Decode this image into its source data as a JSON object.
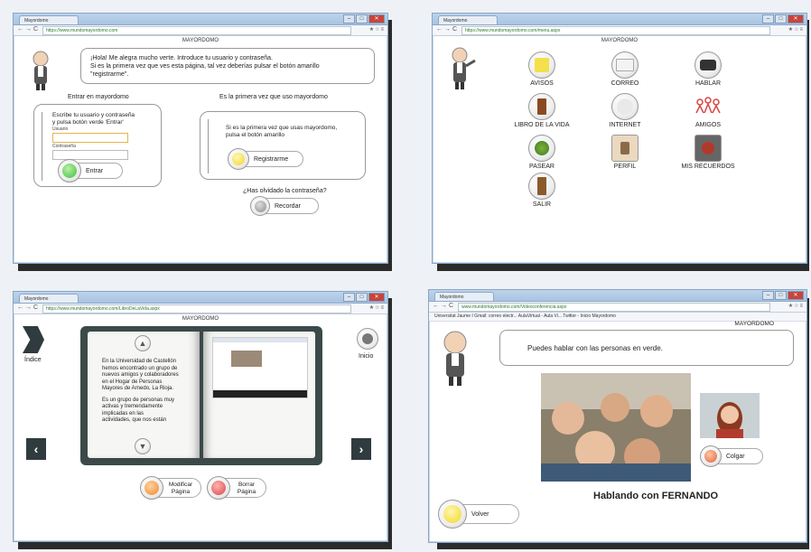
{
  "screen1": {
    "tab_title": "Mayordomo",
    "url": "https://www.mundomayordomo.com",
    "page_header": "MAYORDOMO",
    "bubble_lines": [
      "¡Hola! Me alegra mucho verte. Introduce tu usuario y contraseña.",
      "Si es la primera vez que ves esta página, tal vez deberías pulsar el botón amarillo",
      "\"registrarme\"."
    ],
    "login_title": "Entrar en mayordomo",
    "login_instructions": [
      "Escribe tu usuario y contraseña",
      "y pulsa botón verde 'Entrar'"
    ],
    "user_label": "Usuario",
    "password_label": "Contraseña",
    "enter_button": "Entrar",
    "first_time_title": "Es la primera vez que uso mayordomo",
    "first_time_text": [
      "Si es la primera vez que usas mayordomo,",
      "pulsa el botón amarillo"
    ],
    "register_button": "Registrarme",
    "forgot_question": "¿Has olvidado la contraseña?",
    "remember_button": "Recordar"
  },
  "screen2": {
    "tab_title": "Mayordomo",
    "url": "https://www.mundomayordomo.com/menu.aspx",
    "page_header": "MAYORDOMO",
    "icons": [
      {
        "label": "AVISOS",
        "icon": "notes-icon"
      },
      {
        "label": "CORREO",
        "icon": "mail-icon"
      },
      {
        "label": "HABLAR",
        "icon": "phone-icon"
      },
      {
        "label": "LIBRO DE LA VIDA",
        "icon": "book-icon"
      },
      {
        "label": "INTERNET",
        "icon": "internet-icon"
      },
      {
        "label": "AMIGOS",
        "icon": "friends-icon"
      },
      {
        "label": "PASEAR",
        "icon": "tree-icon"
      },
      {
        "label": "PERFIL",
        "icon": "profile-icon"
      },
      {
        "label": "MIS RECUERDOS",
        "icon": "gramophone-icon"
      },
      {
        "label": "SALIR",
        "icon": "door-icon"
      }
    ]
  },
  "screen3": {
    "tab_title": "Mayordomo",
    "url": "https://www.mundomayordomo.com/LibroDeLaVida.aspx",
    "page_header": "MAYORDOMO",
    "index_label": "Índice",
    "home_label": "Inicio",
    "book_text_1": [
      "En la Universidad de Castellón",
      "hemos encontrado un grupo de",
      "nuevos amigos y colaboradores",
      "en el Hogar de Personas",
      "Mayores de Arnedo, La Rioja."
    ],
    "book_text_2": [
      "Es un grupo de personas muy",
      "activas y tremendamente",
      "implicadas en las",
      "actividades, que nos están"
    ],
    "modify_button": [
      "Modificar",
      "Página"
    ],
    "delete_button": [
      "Borrar",
      "Página"
    ]
  },
  "screen4": {
    "tab_title": "Mayordomo",
    "url": "www.mundomayordomo.com/Videoconferencia.aspx",
    "bookmarks": "Universitat Jaume I   Gmail: correo electr...   AulaVirtual - Aula Vi...   Twitter - Inicio   Mayordomo",
    "page_header": "MAYORDOMO",
    "bubble": "Puedes hablar con las personas en verde.",
    "hangup_button": "Colgar",
    "talking_label": "Hablando con FERNANDO",
    "back_button": "Volver"
  },
  "colors": {
    "green": "#3fbf3a",
    "yellow": "#f2d62a",
    "gray": "#8c8c8c",
    "orange": "#f08a2a",
    "red": "#d94545",
    "window_border": "#8aa6c6"
  }
}
